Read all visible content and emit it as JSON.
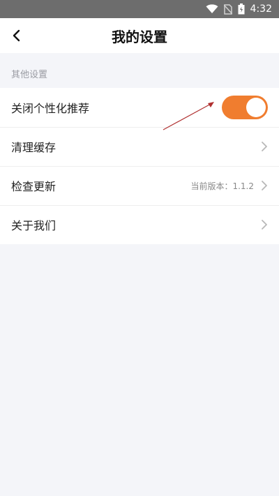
{
  "status_bar": {
    "time": "4:32",
    "icons": [
      "wifi-icon",
      "no-sim-icon",
      "battery-icon"
    ]
  },
  "header": {
    "title": "我的设置",
    "back_icon": "chevron-left-icon"
  },
  "section": {
    "title": "其他设置"
  },
  "items": [
    {
      "label": "关闭个性化推荐",
      "control": "toggle",
      "toggle_on": true
    },
    {
      "label": "清理缓存",
      "control": "chevron"
    },
    {
      "label": "检查更新",
      "value": "当前版本：1.1.2",
      "control": "chevron"
    },
    {
      "label": "关于我们",
      "control": "chevron"
    }
  ],
  "colors": {
    "accent": "#f07d2f",
    "status_bar": "#6d6d6d",
    "background": "#f4f5f9",
    "annotation_arrow": "#b03030"
  }
}
